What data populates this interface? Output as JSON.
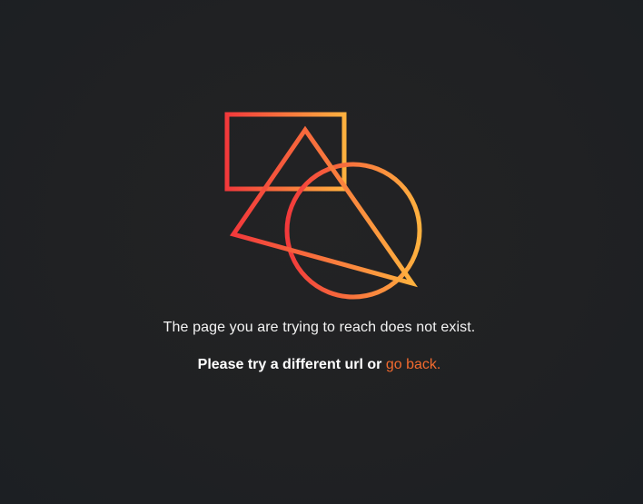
{
  "illustration": {
    "icon": "broken-shapes-icon",
    "gradient_start": "#f2393b",
    "gradient_end": "#ffb13f"
  },
  "message": {
    "primary": "The page you are trying to reach does not exist.",
    "hint_prefix": "Please try a different url or ",
    "go_back_label": "go back."
  },
  "colors": {
    "background": "#202123",
    "text": "#ffffff",
    "link": "#f26a2e"
  }
}
